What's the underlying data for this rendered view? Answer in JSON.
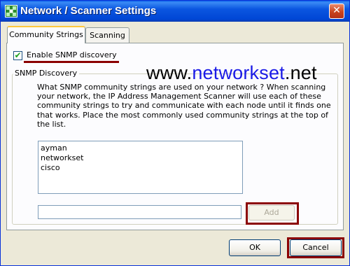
{
  "window": {
    "title": "Network / Scanner Settings",
    "close_glyph": "✕",
    "icon": "network-app-icon"
  },
  "tabs": [
    {
      "label": "Community Strings",
      "active": true
    },
    {
      "label": "Scanning",
      "active": false
    }
  ],
  "snmp": {
    "enable_label": "Enable SNMP discovery",
    "enable_checked": true,
    "group_title": "SNMP Discovery",
    "description": "What SNMP community strings are used on your network ?  When scanning your network, the IP Address Management Scanner will use each of these community strings to try and communicate with each node until it finds one that works. Place the most commonly used community strings at the top of the list.",
    "community_strings": [
      "ayman",
      "networkset",
      "cisco"
    ],
    "new_string_value": "",
    "add_label": "Add"
  },
  "watermark": {
    "part1": "www.",
    "part2": "networkset",
    "part3": ".net"
  },
  "buttons": {
    "ok_label": "OK",
    "cancel_label": "Cancel"
  },
  "colors": {
    "titlebar": "#0046D5",
    "annotation_red": "#8B0000",
    "watermark_blue": "#1A1AE6",
    "tab_highlight": "#FFC83C"
  }
}
